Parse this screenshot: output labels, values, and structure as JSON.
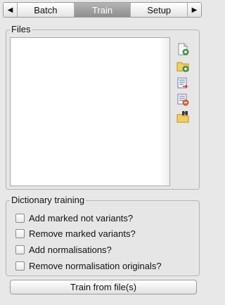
{
  "tabs": {
    "left_arrow": "◀",
    "right_arrow": "▶",
    "items": [
      {
        "label": "Batch"
      },
      {
        "label": "Train",
        "active": true
      },
      {
        "label": "Setup"
      }
    ]
  },
  "files": {
    "title": "Files",
    "toolbar_icons": [
      "add-file-icon",
      "add-folder-icon",
      "export-list-icon",
      "remove-file-icon",
      "browse-folder-icon"
    ]
  },
  "dictionary": {
    "title": "Dictionary training",
    "options": [
      {
        "label": "Add marked not variants?",
        "checked": false
      },
      {
        "label": "Remove marked variants?",
        "checked": false
      },
      {
        "label": "Add normalisations?",
        "checked": false
      },
      {
        "label": "Remove normalisation originals?",
        "checked": false
      }
    ]
  },
  "train_button": {
    "label": "Train from file(s)"
  },
  "colors": {
    "active_tab": "#a0a0a0",
    "panel_bg": "#e8e8e8",
    "list_bg": "#ffffff"
  }
}
